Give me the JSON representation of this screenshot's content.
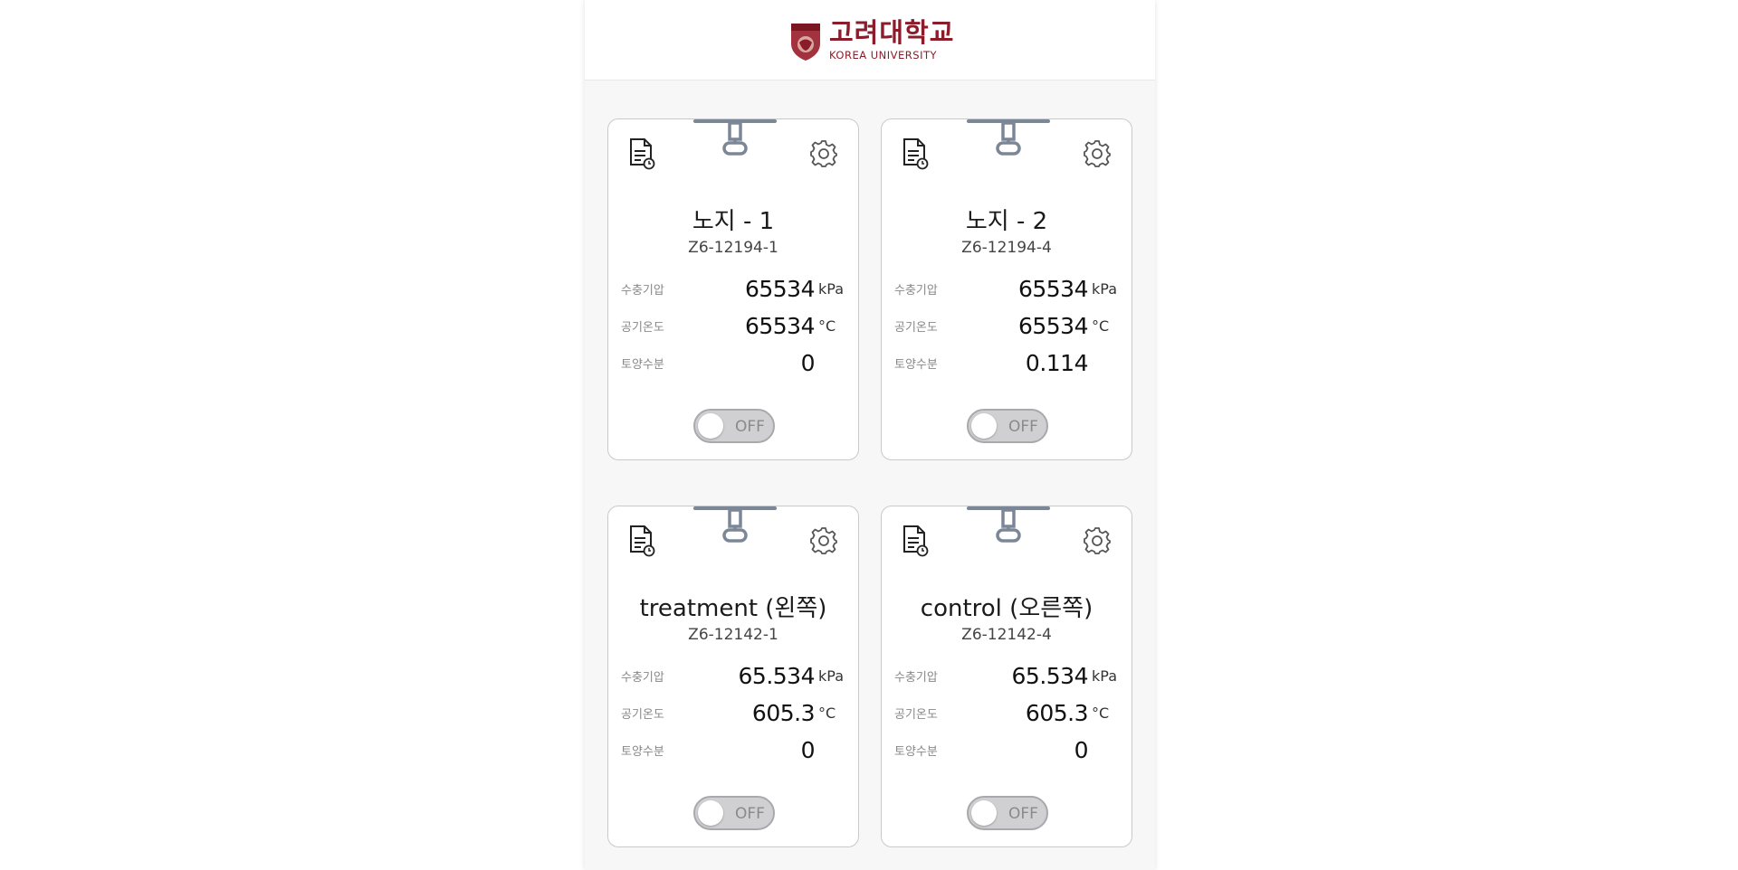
{
  "header": {
    "logo_ko": "고려대학교",
    "logo_en": "KOREA UNIVERSITY",
    "brand_color": "#8b1c2a"
  },
  "labels": {
    "water_pressure": "수충기압",
    "air_temp": "공기온도",
    "soil_moisture": "토양수분"
  },
  "units": {
    "pressure": "kPa",
    "temperature": "°C"
  },
  "cards": [
    {
      "name": "노지 - 1",
      "serial": "Z6-12194-1",
      "water_pressure": "65534",
      "air_temp": "65534",
      "soil_moisture": "0",
      "toggle_state": "OFF"
    },
    {
      "name": "노지 - 2",
      "serial": "Z6-12194-4",
      "water_pressure": "65534",
      "air_temp": "65534",
      "soil_moisture": "0.114",
      "toggle_state": "OFF"
    },
    {
      "name": "treatment (왼쪽)",
      "serial": "Z6-12142-1",
      "water_pressure": "65.534",
      "air_temp": "605.3",
      "soil_moisture": "0",
      "toggle_state": "OFF"
    },
    {
      "name": "control (오른쪽)",
      "serial": "Z6-12142-4",
      "water_pressure": "65.534",
      "air_temp": "605.3",
      "soil_moisture": "0",
      "toggle_state": "OFF"
    }
  ]
}
